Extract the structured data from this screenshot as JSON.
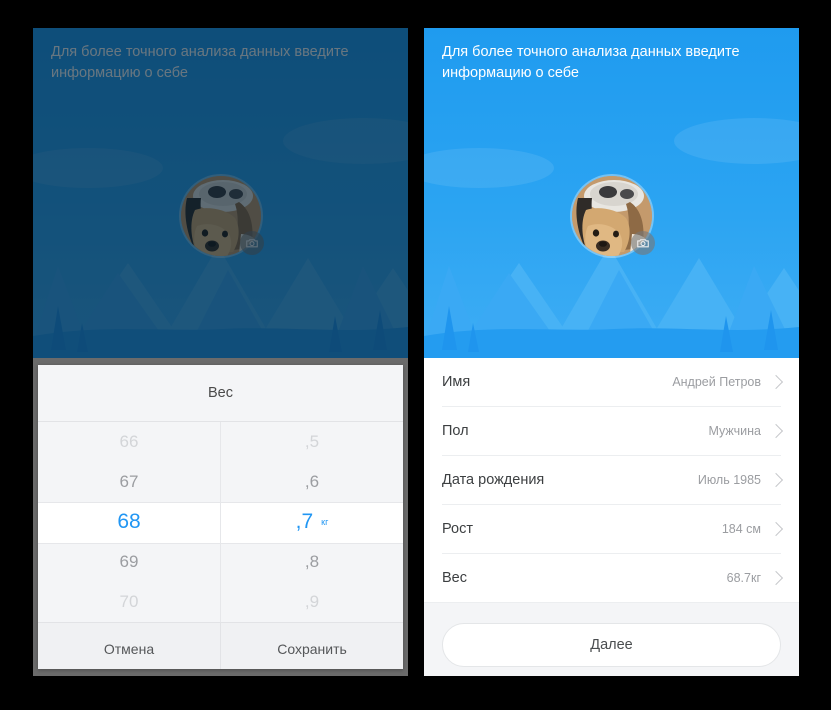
{
  "screen": {
    "background_color": "#000000",
    "accent_color": "#2196f3",
    "sky_color": "#2ba4f2",
    "dim_color": "#114466"
  },
  "hero": {
    "title": "Для более точного анализа данных введите\nинформацию о себе",
    "avatar_name": "dog-avatar",
    "camera_badge_name": "camera-icon"
  },
  "left_panel": {
    "state": "weight-picker-open",
    "picker": {
      "title": "Вес",
      "unit": "кг",
      "integer_column": {
        "items": [
          "66",
          "67",
          "68",
          "69",
          "70"
        ],
        "selected_index": 2,
        "selected_value": "68"
      },
      "decimal_column": {
        "items": [
          ",5",
          ",6",
          ",7",
          ",8",
          ",9"
        ],
        "selected_index": 2,
        "selected_value": ",7"
      },
      "cancel_label": "Отмена",
      "save_label": "Сохранить"
    }
  },
  "right_panel": {
    "state": "profile-list",
    "rows": [
      {
        "label": "Имя",
        "value": "Андрей Петров"
      },
      {
        "label": "Пол",
        "value": "Мужчина"
      },
      {
        "label": "Дата рождения",
        "value": "Июль 1985"
      },
      {
        "label": "Рост",
        "value": "184 см"
      },
      {
        "label": "Вес",
        "value": "68.7кг"
      }
    ],
    "next_label": "Далее"
  }
}
